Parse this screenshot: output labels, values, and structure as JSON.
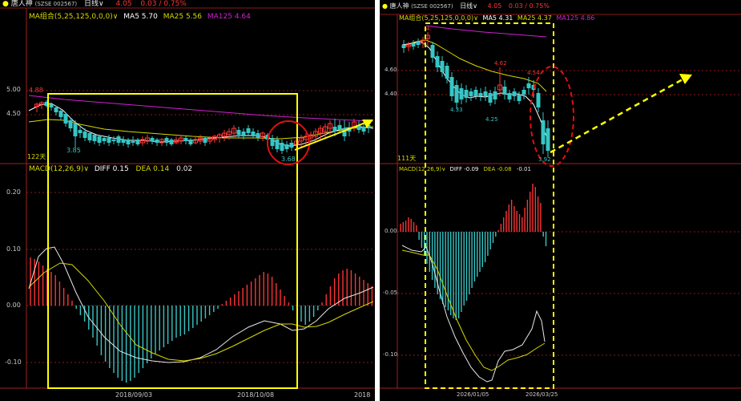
{
  "colors": {
    "background": "#000000",
    "grid_red": "#8b1a1a",
    "axis_red": "#a02020",
    "up_red": "#ff3333",
    "down_cyan": "#36c6c6",
    "ma5_white": "#ffffff",
    "ma25_yellow": "#d8d800",
    "ma125_magenta": "#d020d0",
    "label_gray": "#c8c8c8",
    "highlight_yellow": "#ffff00",
    "highlight_red": "#e01010"
  },
  "left": {
    "header": {
      "stock": "唐人神",
      "code": "(SZSE 002567)",
      "period": "日线",
      "price": "4.05",
      "change": "0.03 / 0.75%"
    },
    "ma_legend": {
      "label": "MA组合(5,25,125,0,0,0)",
      "ma5": "MA5 5.70",
      "ma25": "MA25 5.56",
      "ma125": "MA125 4.64"
    },
    "price_ticks": [
      "5.00",
      "4.50"
    ],
    "markers": {
      "high": "4.88",
      "low1": "3.85",
      "low2": "3.68"
    },
    "count": "122天",
    "macd_legend": {
      "label": "MACD(12,26,9)",
      "diff": "DIFF 0.15",
      "dea": "DEA 0.14",
      "value": "0.02"
    },
    "macd_ticks": [
      "0.20",
      "0.10",
      "0.00",
      "-0.10"
    ],
    "dates": [
      "2018/09/03",
      "2018/10/08",
      "2018"
    ]
  },
  "right": {
    "header": {
      "stock": "唐人神",
      "code": "(SZSE 002567)",
      "period": "日线",
      "price": "4.05",
      "change": "0.03 / 0.75%"
    },
    "ma_legend": {
      "label": "MA组合(5,25,125,0,0,0)",
      "ma5": "MA5 4.31",
      "ma25": "MA25 4.37",
      "ma125": "MA125 4.86"
    },
    "price_ticks": [
      "4.60",
      "4.40"
    ],
    "markers": {
      "high": "4.62",
      "high2": "4.54",
      "low1": "4.33",
      "low2": "4.25",
      "low3": "3.92",
      "top": "4."
    },
    "count": "111天",
    "macd_legend": {
      "label": "MACD(12,26,9)",
      "diff": "DIFF -0.09",
      "dea": "DEA -0.08",
      "value": "-0.01"
    },
    "macd_ticks": [
      "0.00",
      "-0.05",
      "-0.10"
    ],
    "dates": [
      "2026/01/05",
      "2026/03/25"
    ]
  }
}
